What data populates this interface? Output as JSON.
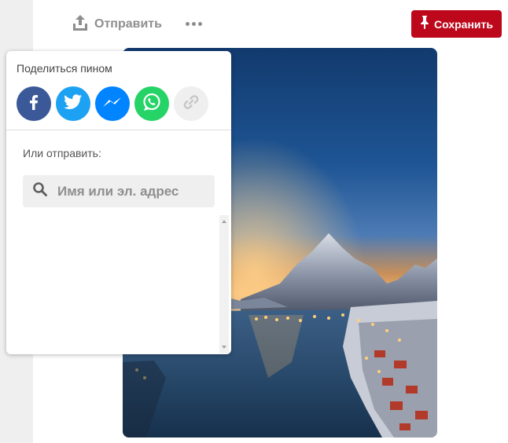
{
  "header": {
    "send_label": "Отправить",
    "save_label": "Сохранить"
  },
  "share": {
    "title": "Поделиться пином",
    "services": [
      {
        "name": "facebook",
        "color": "#3b5998"
      },
      {
        "name": "twitter",
        "color": "#1da1f2"
      },
      {
        "name": "messenger",
        "color": "#0084ff"
      },
      {
        "name": "whatsapp",
        "color": "#25d366"
      },
      {
        "name": "copy-link",
        "color": "#efefef"
      }
    ],
    "send_label": "Или отправить:",
    "search_placeholder": "Имя или эл. адрес",
    "search_value": ""
  },
  "colors": {
    "accent": "#bd081c",
    "muted_text": "#8e8e8e",
    "page_bg": "#efefef"
  }
}
